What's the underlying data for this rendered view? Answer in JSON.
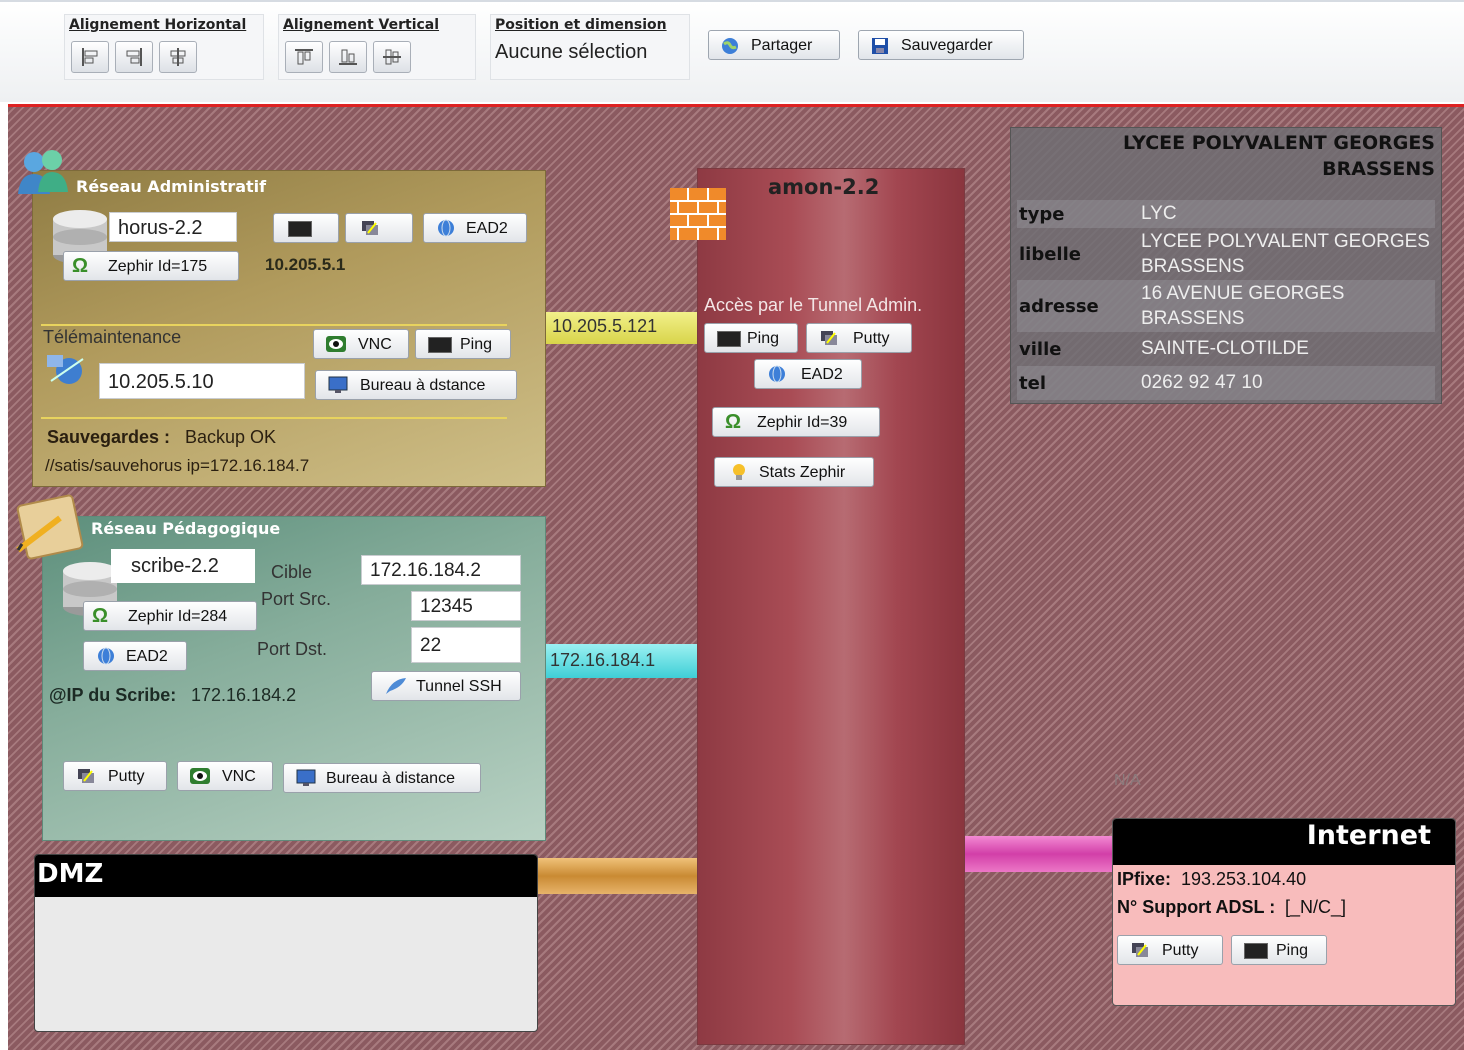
{
  "toolbar": {
    "align_h_title": "Alignement Horizontal",
    "align_v_title": "Alignement Vertical",
    "pos_title": "Position et dimension",
    "pos_value": "Aucune sélection",
    "share_label": "Partager",
    "save_label": "Sauvegarder"
  },
  "admin": {
    "title": "Réseau Administratif",
    "server_name": "horus-2.2",
    "zephir_label": "Zephir Id=175",
    "ip": "10.205.5.1",
    "ead_label": "EAD2",
    "telemaintenance_label": "Télémaintenance",
    "vnc_label": "VNC",
    "ping_label": "Ping",
    "remote_ip": "10.205.5.10",
    "remote_desktop_label": "Bureau à dstance",
    "backup_label": "Sauvegardes :",
    "backup_status": "Backup OK",
    "backup_path": "//satis/sauvehorus ip=172.16.184.7",
    "link_ip": "10.205.5.121"
  },
  "peda": {
    "title": "Réseau Pédagogique",
    "server_name": "scribe-2.2",
    "zephir_label": "Zephir Id=284",
    "ead_label": "EAD2",
    "cible_label": "Cible",
    "cible_value": "172.16.184.2",
    "port_src_label": "Port Src.",
    "port_src_value": "12345",
    "port_dst_label": "Port Dst.",
    "port_dst_value": "22",
    "tunnel_label": "Tunnel SSH",
    "ip_label": "@IP du Scribe:",
    "ip_value": "172.16.184.2",
    "putty_label": "Putty",
    "vnc_label": "VNC",
    "remote_desktop_label": "Bureau à distance",
    "link_ip": "172.16.184.1"
  },
  "amon": {
    "title": "amon-2.2",
    "tunnel_access": "Accès par le Tunnel Admin.",
    "ping_label": "Ping",
    "putty_label": "Putty",
    "ead_label": "EAD2",
    "zephir_label": "Zephir Id=39",
    "stats_label": "Stats Zephir"
  },
  "school": {
    "title_line1": "LYCEE POLYVALENT GEORGES",
    "title_line2": "BRASSENS",
    "rows": [
      {
        "key": "type",
        "value": "LYC"
      },
      {
        "key": "libelle",
        "value": "LYCEE POLYVALENT GEORGES BRASSENS"
      },
      {
        "key": "adresse",
        "value": "16 AVENUE GEORGES BRASSENS"
      },
      {
        "key": "ville",
        "value": "SAINTE-CLOTILDE"
      },
      {
        "key": "tel",
        "value": "0262 92 47 10"
      }
    ]
  },
  "dmz": {
    "title": "DMZ"
  },
  "internet": {
    "title": "Internet",
    "na_label": "N/A",
    "ip_label": "IPfixe:",
    "ip_value": "193.253.104.40",
    "adsl_label": "N° Support ADSL :",
    "adsl_value": "[_N/C_]",
    "putty_label": "Putty",
    "ping_label": "Ping"
  },
  "colors": {
    "accent_red": "#dd2222",
    "link_yellow": "#e5e35a",
    "link_cyan": "#5fdde2",
    "link_orange": "#e0a14c",
    "link_pink": "#e04cb8"
  },
  "icons": [
    "align-left-icon",
    "align-right-icon",
    "align-center-icon",
    "align-top-icon",
    "align-bottom-icon",
    "align-middle-icon",
    "globe-icon",
    "floppy-icon",
    "users-icon",
    "database-icon",
    "terminal-icon",
    "putty-icon",
    "omega-icon",
    "eye-icon",
    "monitor-icon",
    "network-icon",
    "notebook-icon",
    "firewall-icon",
    "lightbulb-icon",
    "feather-icon"
  ]
}
